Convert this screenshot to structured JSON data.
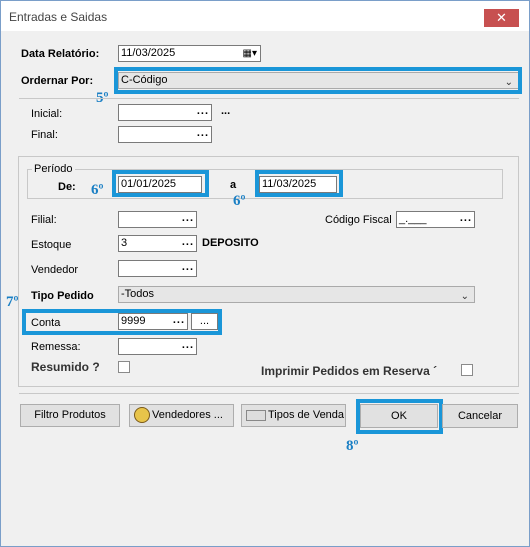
{
  "window": {
    "title": "Entradas e Saidas",
    "close": "✕"
  },
  "data_relatorio": {
    "label": "Data Relatório:",
    "value": "11/03/2025"
  },
  "ordenar": {
    "label": "Ordernar Por:",
    "value": "C-Código"
  },
  "inicial": {
    "label": "Inicial:",
    "extra": "..."
  },
  "final": {
    "label": "Final:"
  },
  "periodo": {
    "legend": "Período",
    "de_label": "De:",
    "de_value": "01/01/2025",
    "a_label": "a",
    "a_value": "11/03/2025"
  },
  "filial": {
    "label": "Filial:"
  },
  "codigo_fiscal": {
    "label": "Código Fiscal",
    "value": "_.___"
  },
  "estoque": {
    "label": "Estoque",
    "value": "3",
    "desc": "DEPOSITO"
  },
  "vendedor": {
    "label": "Vendedor"
  },
  "tipo_pedido": {
    "label": "Tipo Pedido",
    "value": "-Todos"
  },
  "conta": {
    "label": "Conta",
    "value": "9999"
  },
  "remessa": {
    "label": "Remessa:"
  },
  "resumido": {
    "label": "Resumido ?"
  },
  "imprimir": {
    "label": "Imprimir Pedidos em Reserva ´"
  },
  "buttons": {
    "filtro": "Filtro Produtos",
    "vendedores": "Vendedores ...",
    "tipos": "Tipos de Venda",
    "ok": "OK",
    "cancelar": "Cancelar"
  },
  "annotations": {
    "a5": "5º",
    "a6a": "6º",
    "a6b": "6º",
    "a7": "7º",
    "a8": "8º"
  },
  "dots": "...",
  "colors": {
    "highlight": "#1a96d8",
    "annotation": "#1a7fc4",
    "close": "#c75050"
  }
}
